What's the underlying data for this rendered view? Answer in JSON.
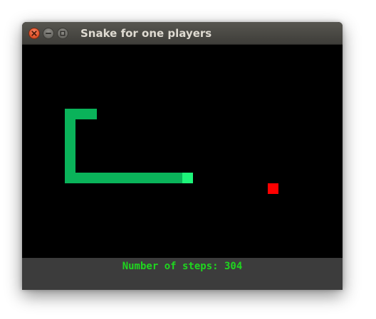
{
  "window": {
    "title": "Snake for one players",
    "buttons": [
      "close-icon",
      "minimize-icon",
      "maximize-icon"
    ]
  },
  "game": {
    "cell_size_units": 15,
    "grid_columns": 30,
    "grid_rows": 20,
    "snake": {
      "head": [
        15,
        12
      ],
      "body": [
        [
          6,
          12
        ],
        [
          7,
          12
        ],
        [
          8,
          12
        ],
        [
          9,
          12
        ],
        [
          10,
          12
        ],
        [
          11,
          12
        ],
        [
          12,
          12
        ],
        [
          13,
          12
        ],
        [
          14,
          12
        ],
        [
          4,
          12
        ],
        [
          5,
          12
        ],
        [
          4,
          11
        ],
        [
          4,
          10
        ],
        [
          4,
          9
        ],
        [
          4,
          8
        ],
        [
          4,
          7
        ],
        [
          4,
          6
        ],
        [
          5,
          6
        ],
        [
          6,
          6
        ]
      ],
      "body_color": "#0ab35a",
      "head_color": "#1df57a"
    },
    "food": {
      "cell": [
        23,
        13
      ],
      "color": "#ff0000"
    },
    "background_color": "#000000"
  },
  "status": {
    "steps_label": "Number of steps: 304",
    "steps": 304,
    "color": "#1fd61f"
  }
}
